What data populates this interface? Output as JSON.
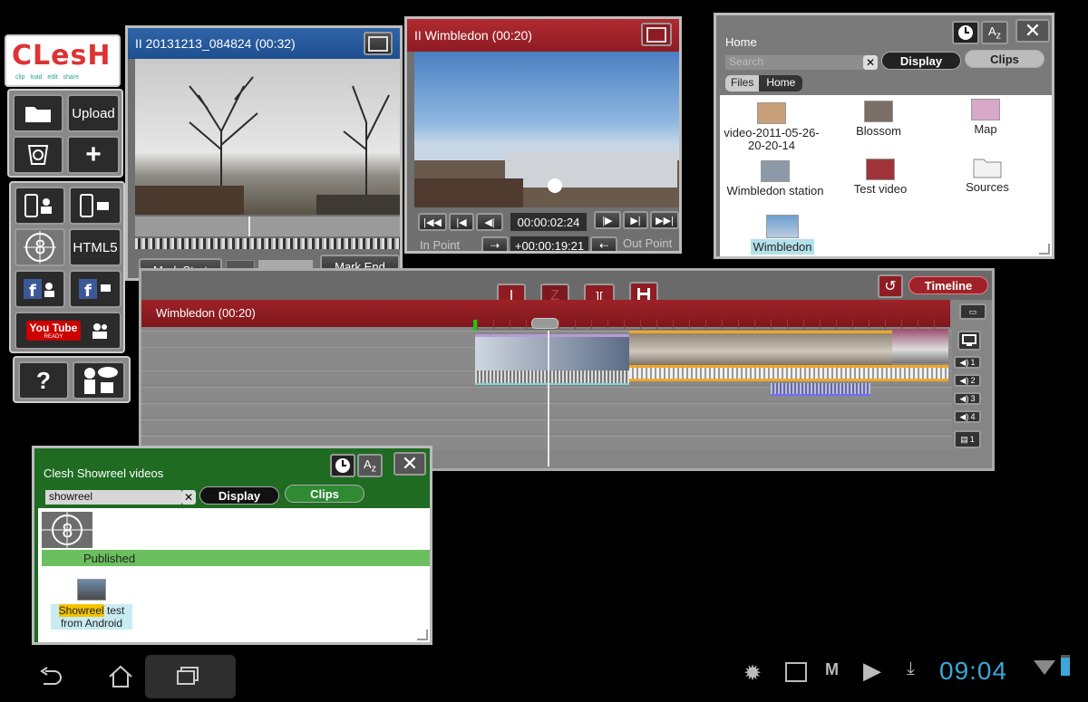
{
  "sidebar": {
    "logo_text": "CLesH",
    "logo_sub": "clip   load   edit   share",
    "upload_label": "Upload",
    "html5_label": "HTML5",
    "youtube_label": "You Tube",
    "youtube_sub": "READY",
    "help_label": "?"
  },
  "player_left": {
    "title": "II 20131213_084824 (00:32)",
    "mark_start": "Mark Start",
    "mark_end": "Mark End"
  },
  "player_right": {
    "title": "II Wimbledon (00:20)",
    "timecode": "00:00:02:24",
    "offset": "+00:00:19:21",
    "in_point": "In Point",
    "out_point": "Out Point"
  },
  "browser": {
    "title": "Home",
    "search_placeholder": "Search",
    "display_label": "Display",
    "clips_label": "Clips",
    "files_label": "Files",
    "home_label": "Home",
    "items": [
      {
        "label": "video-2011-05-26-20-20-14"
      },
      {
        "label": "Blossom"
      },
      {
        "label": "Map"
      },
      {
        "label": "Wimbledon station"
      },
      {
        "label": "Test video"
      },
      {
        "label": "Sources"
      },
      {
        "label": "Wimbledon"
      }
    ]
  },
  "timeline": {
    "title": "Wimbledon (00:20)",
    "timeline_label": "Timeline",
    "track_labels": [
      "1",
      "2",
      "3",
      "4"
    ],
    "subtitle_track": "1"
  },
  "showreel": {
    "title": "Clesh Showreel videos",
    "search_value": "showreel",
    "display_label": "Display",
    "clips_label": "Clips",
    "published_label": "Published",
    "item_highlight": "Showreel",
    "item_rest_line1": " test",
    "item_line2": "from Android"
  },
  "statusbar": {
    "time": "09:04"
  },
  "colors": {
    "blue_title": "#1e4f8f",
    "red_title": "#8e1c22",
    "green_title": "#1f6b22",
    "clock_cyan": "#3aa8d8",
    "published_green": "#6bbf5f"
  }
}
